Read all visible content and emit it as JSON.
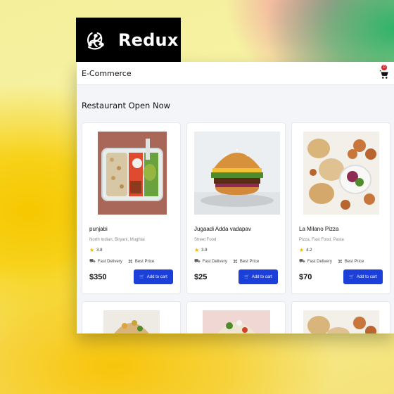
{
  "logo": {
    "text": "Redux",
    "icon": "redux-logo-icon"
  },
  "navbar": {
    "brand": "E-Commerce",
    "cart_count": "0",
    "cart_icon": "cart-icon"
  },
  "section": {
    "title": "Restaurant Open Now"
  },
  "restaurants": [
    {
      "name": "punjabi",
      "cuisine": "North Indian, Biryani, Mughlai",
      "rating": "3.8",
      "delivery": "Fast Delivery",
      "offer": "Best Price",
      "price": "$350",
      "button": "Add to cart"
    },
    {
      "name": "Jugaadi Adda vadapav",
      "cuisine": "Street Food",
      "rating": "3.9",
      "delivery": "Fast Delivery",
      "offer": "Best Price",
      "price": "$25",
      "button": "Add to cart"
    },
    {
      "name": "La Milano Pizza",
      "cuisine": "Pizza, Fast Food, Pasta",
      "rating": "4.2",
      "delivery": "Fast Delivery",
      "offer": "Best Price",
      "price": "$70",
      "button": "Add to cart"
    }
  ],
  "colors": {
    "accent": "#1b3fd8",
    "badge": "#e0212b",
    "star": "#f4b400"
  }
}
